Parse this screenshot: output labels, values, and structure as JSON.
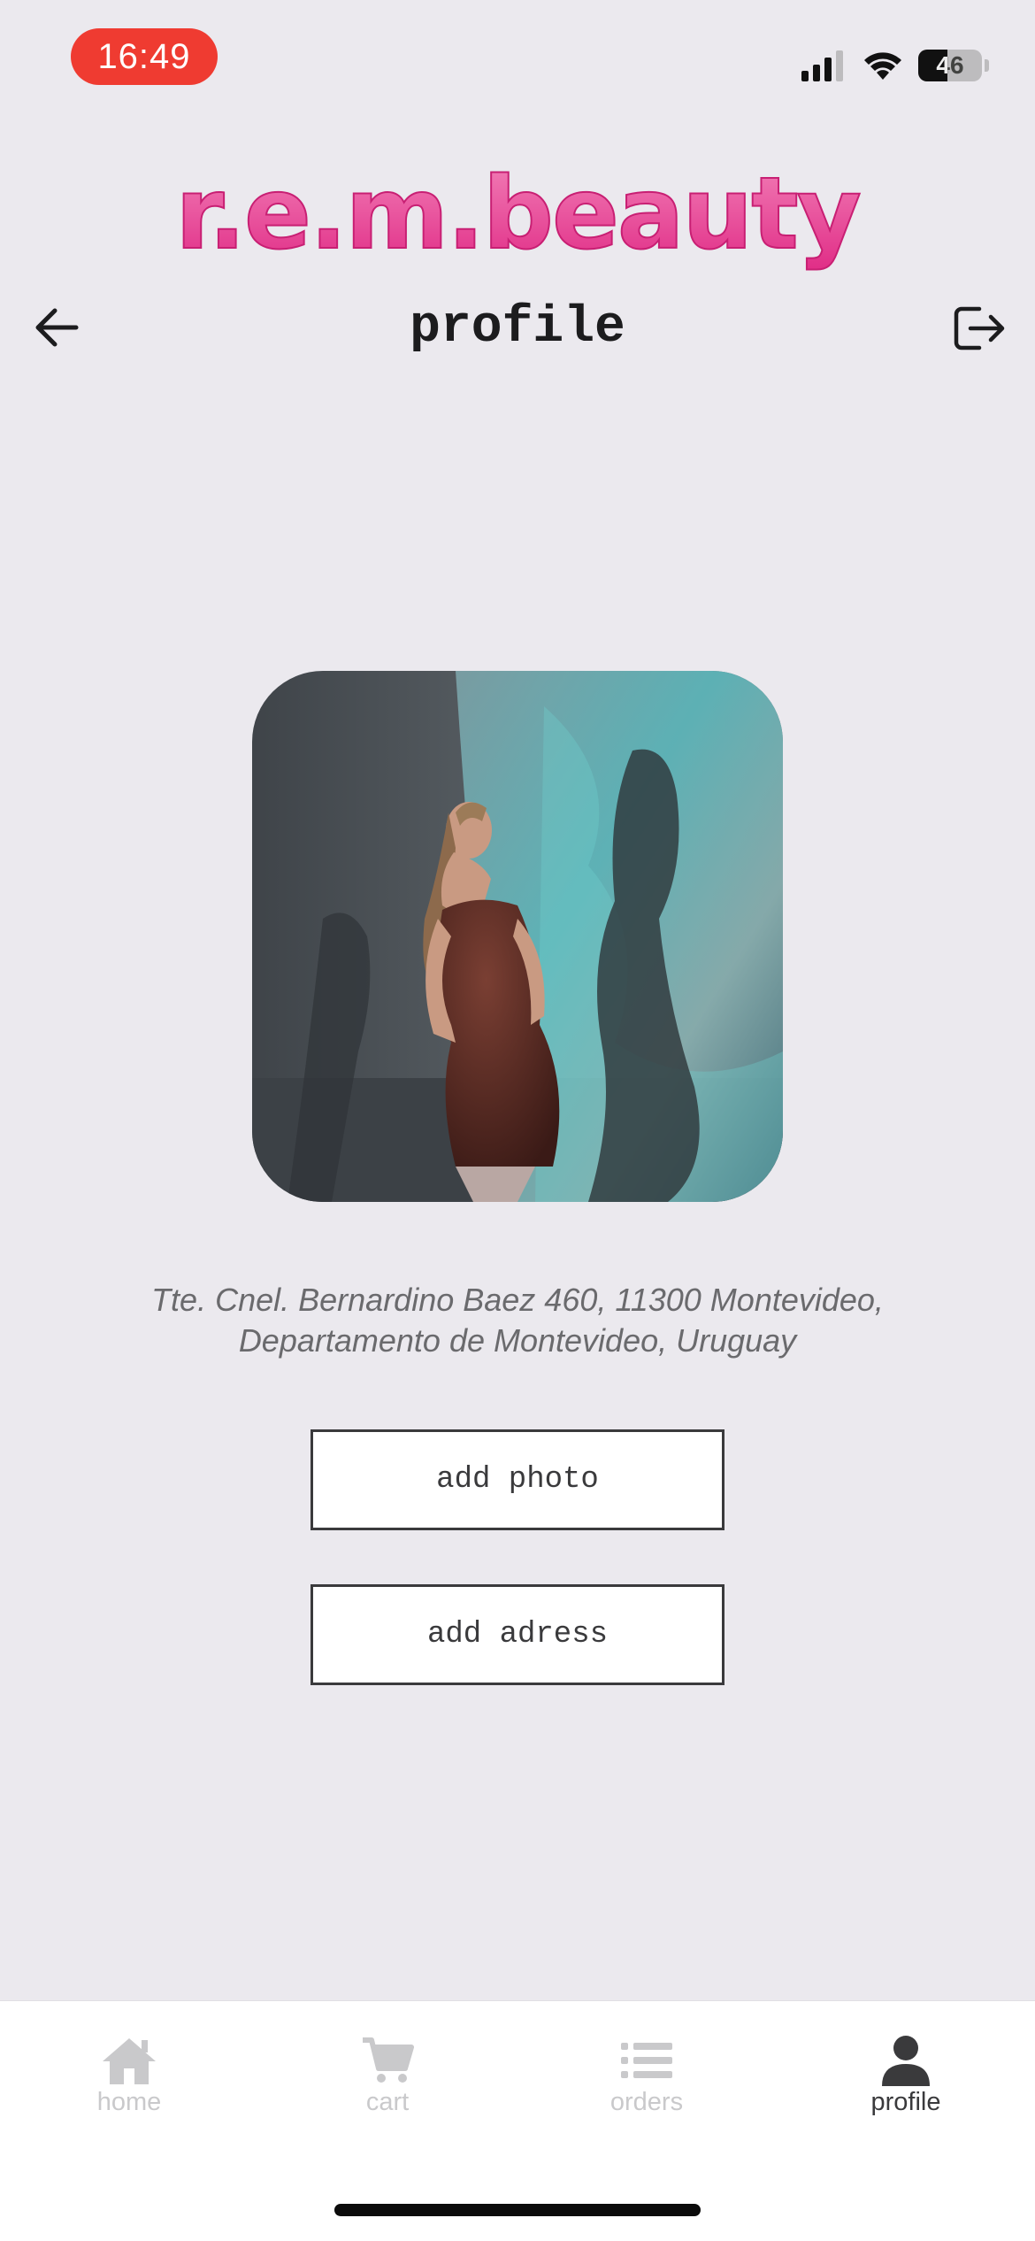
{
  "status_bar": {
    "time": "16:49",
    "battery_level": "46",
    "battery_fraction": 0.46,
    "icons": [
      "cellular-signal-icon",
      "wifi-icon",
      "battery-icon"
    ]
  },
  "brand": {
    "logo_text": "r.e.m.beauty",
    "logo_color": "#e8368f"
  },
  "header": {
    "title": "profile",
    "back_icon": "arrow-left-icon",
    "logout_icon": "logout-icon"
  },
  "profile": {
    "address_line1": "Tte. Cnel. Bernardino Baez 460, 11300 Montevideo,",
    "address_line2": "Departamento de Montevideo, Uruguay"
  },
  "actions": {
    "add_photo": "add photo",
    "add_address": "add adress"
  },
  "tabbar": {
    "items": [
      {
        "label": "home",
        "icon": "home-icon",
        "active": false
      },
      {
        "label": "cart",
        "icon": "cart-icon",
        "active": false
      },
      {
        "label": "orders",
        "icon": "list-icon",
        "active": false
      },
      {
        "label": "profile",
        "icon": "person-icon",
        "active": true
      }
    ],
    "active_color": "#3a3a3c",
    "inactive_color": "#c9c9cb"
  }
}
